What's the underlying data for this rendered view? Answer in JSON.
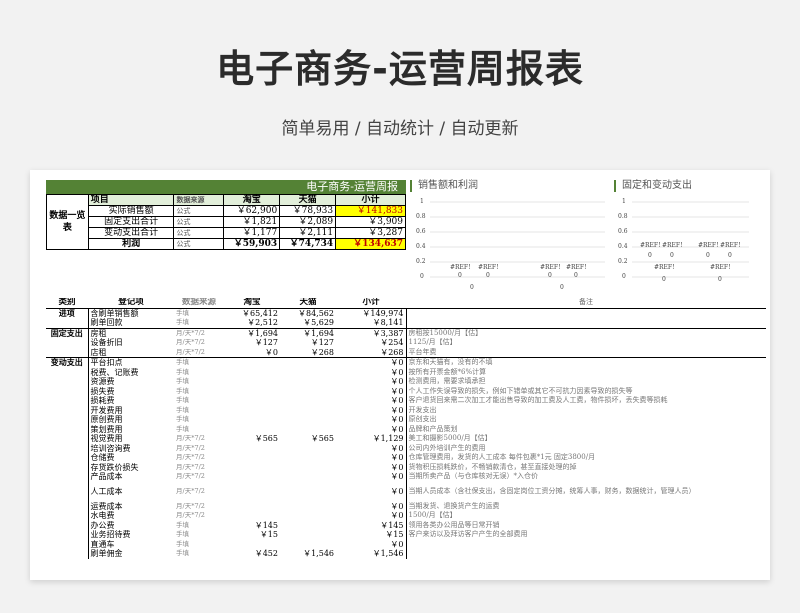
{
  "page": {
    "title": "电子商务-运营周报表",
    "subtitle": "简单易用 / 自动统计 / 自动更新"
  },
  "summary": {
    "banner": "电子商务-运营周报",
    "side_label": "数据一览表",
    "headers": [
      "项目",
      "数据来源",
      "淘宝",
      "天猫",
      "小计"
    ],
    "rows": [
      {
        "item": "实际销售额",
        "source": "公式",
        "taobao": "￥62,900",
        "tmall": "￥78,933",
        "total": "￥141,833",
        "highlight": true
      },
      {
        "item": "固定支出合计",
        "source": "公式",
        "taobao": "￥1,821",
        "tmall": "￥2,089",
        "total": "￥3,909",
        "highlight": false
      },
      {
        "item": "变动支出合计",
        "source": "公式",
        "taobao": "￥1,177",
        "tmall": "￥2,111",
        "total": "￥3,287",
        "highlight": false
      },
      {
        "item": "利润",
        "source": "公式",
        "taobao": "￥59,903",
        "tmall": "￥74,734",
        "total": "￥134,637",
        "highlight": true
      }
    ]
  },
  "charts": {
    "sales_profit": {
      "title": "销售额和利润",
      "yticks": [
        "1",
        "0.8",
        "0.6",
        "0.4",
        "0.2",
        "0"
      ],
      "ref": "#REF!",
      "zero": "0"
    },
    "fixed_variable": {
      "title": "固定和变动支出",
      "yticks": [
        "1",
        "0.8",
        "0.6",
        "0.4",
        "0.2",
        "0"
      ],
      "ref": "#REF!",
      "zero": "0"
    }
  },
  "detail": {
    "headers": [
      "类别",
      "登记项",
      "数据来源",
      "淘宝",
      "天猫",
      "小计",
      "备注"
    ],
    "rows": [
      {
        "cat": "进项",
        "item": "含刷单销售额",
        "src": "手填",
        "tb": "￥65,412",
        "tm": "￥84,562",
        "total": "￥149,974",
        "note": ""
      },
      {
        "cat": "",
        "item": "刷单回款",
        "src": "手填",
        "tb": "￥2,512",
        "tm": "￥5,629",
        "total": "￥8,141",
        "note": ""
      },
      {
        "cat": "固定支出",
        "item": "房租",
        "src": "月/天*7/2",
        "tb": "￥1,694",
        "tm": "￥1,694",
        "total": "￥3,387",
        "note": "房租按15000/月【估】"
      },
      {
        "cat": "",
        "item": "设备折旧",
        "src": "月/天*7/2",
        "tb": "￥127",
        "tm": "￥127",
        "total": "￥254",
        "note": "1125/月【估】"
      },
      {
        "cat": "",
        "item": "店租",
        "src": "月/天*7/2",
        "tb": "￥0",
        "tm": "￥268",
        "total": "￥268",
        "note": "平台年费"
      },
      {
        "cat": "变动支出",
        "item": "平台扣点",
        "src": "手填",
        "tb": "",
        "tm": "",
        "total": "￥0",
        "note": "京东和天猫有，没有的不填"
      },
      {
        "cat": "",
        "item": "税费、记账费",
        "src": "手填",
        "tb": "",
        "tm": "",
        "total": "￥0",
        "note": "按所有开票金额*6%计算"
      },
      {
        "cat": "",
        "item": "资源费",
        "src": "手填",
        "tb": "",
        "tm": "",
        "total": "￥0",
        "note": "检测费用，需要求填承担"
      },
      {
        "cat": "",
        "item": "损失费",
        "src": "手填",
        "tb": "",
        "tm": "",
        "total": "￥0",
        "note": "个人工作失误导致的损失，例如下错单或其它不可抗力因素导致的损失等"
      },
      {
        "cat": "",
        "item": "损耗费",
        "src": "手填",
        "tb": "",
        "tm": "",
        "total": "￥0",
        "note": "客户退货回来需二次加工才能出售导致的加工费及人工费，物件损坏，丢失费等损耗"
      },
      {
        "cat": "",
        "item": "开发费用",
        "src": "手填",
        "tb": "",
        "tm": "",
        "total": "￥0",
        "note": "开发支出"
      },
      {
        "cat": "",
        "item": "原创费用",
        "src": "手填",
        "tb": "",
        "tm": "",
        "total": "￥0",
        "note": "原创支出"
      },
      {
        "cat": "",
        "item": "策划费用",
        "src": "手填",
        "tb": "",
        "tm": "",
        "total": "￥0",
        "note": "品牌和产品策划"
      },
      {
        "cat": "",
        "item": "视觉费用",
        "src": "月/天*7/2",
        "tb": "￥565",
        "tm": "￥565",
        "total": "￥1,129",
        "note": "美工和摄影5000/月【估】"
      },
      {
        "cat": "",
        "item": "培训咨询费",
        "src": "月/天*7/2",
        "tb": "",
        "tm": "",
        "total": "￥0",
        "note": "公司内外培训产生的费用"
      },
      {
        "cat": "",
        "item": "仓储费",
        "src": "月/天*7/2",
        "tb": "",
        "tm": "",
        "total": "￥0",
        "note": "仓库管理费用，发货的人工成本    每件包裹*1元  固定3800/月"
      },
      {
        "cat": "",
        "item": "存货跌价损失",
        "src": "月/天*7/2",
        "tb": "",
        "tm": "",
        "total": "￥0",
        "note": "货物积压损耗跌价，不畅销款清仓，甚至直接处理的掉"
      },
      {
        "cat": "",
        "item": "产品成本",
        "src": "月/天*7/2",
        "tb": "",
        "tm": "",
        "total": "￥0",
        "note": "当期所卖产品（与仓库核对无误）*入仓价"
      },
      {
        "cat": "",
        "item": "人工成本",
        "src": "月/天*7/2",
        "tb": "",
        "tm": "",
        "total": "￥0",
        "note": "当期人员成本（含社保支出，含固定岗位工资分摊，统筹人事，财务，数据统计，管理人员）",
        "tall": true
      },
      {
        "cat": "",
        "item": "运费成本",
        "src": "月/天*7/2",
        "tb": "",
        "tm": "",
        "total": "￥0",
        "note": "当期发货、退换货产生的运费"
      },
      {
        "cat": "",
        "item": "水电费",
        "src": "月/天*7/2",
        "tb": "",
        "tm": "",
        "total": "￥0",
        "note": "1500/月【估】"
      },
      {
        "cat": "",
        "item": "办公费",
        "src": "手填",
        "tb": "￥145",
        "tm": "",
        "total": "￥145",
        "note": "领用各类办公用品等日常开销"
      },
      {
        "cat": "",
        "item": "业务招待费",
        "src": "手填",
        "tb": "￥15",
        "tm": "",
        "total": "￥15",
        "note": "客户来访以及拜访客户产生的全部费用"
      },
      {
        "cat": "",
        "item": "直通车",
        "src": "手填",
        "tb": "",
        "tm": "",
        "total": "￥0",
        "note": ""
      },
      {
        "cat": "",
        "item": "刷单佣金",
        "src": "手填",
        "tb": "￥452",
        "tm": "￥1,546",
        "total": "￥1,546",
        "note": ""
      }
    ]
  }
}
